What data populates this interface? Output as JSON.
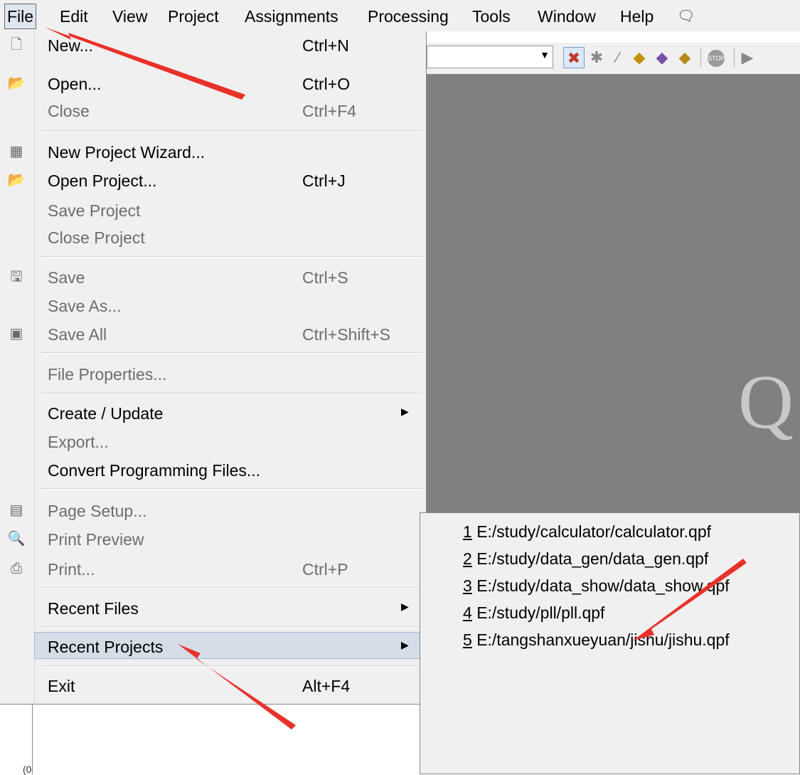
{
  "menubar": {
    "items": [
      {
        "label": "File"
      },
      {
        "label": "Edit"
      },
      {
        "label": "View"
      },
      {
        "label": "Project"
      },
      {
        "label": "Assignments"
      },
      {
        "label": "Processing"
      },
      {
        "label": "Tools"
      },
      {
        "label": "Window"
      },
      {
        "label": "Help"
      }
    ]
  },
  "toolbar": {
    "stop_label": "STOP"
  },
  "workspace": {
    "logo_letter": "Q"
  },
  "file_menu": {
    "items": [
      {
        "label": "New...",
        "shortcut": "Ctrl+N",
        "icon": "new-file-icon"
      },
      {
        "label": "Open...",
        "shortcut": "Ctrl+O",
        "icon": "open-folder-icon"
      },
      {
        "label": "Close",
        "shortcut": "Ctrl+F4"
      },
      {
        "label": "New Project Wizard...",
        "icon": "project-wizard-icon"
      },
      {
        "label": "Open Project...",
        "shortcut": "Ctrl+J",
        "icon": "open-project-icon"
      },
      {
        "label": "Save Project"
      },
      {
        "label": "Close Project"
      },
      {
        "label": "Save",
        "shortcut": "Ctrl+S",
        "icon": "save-icon"
      },
      {
        "label": "Save As..."
      },
      {
        "label": "Save All",
        "shortcut": "Ctrl+Shift+S",
        "icon": "save-all-icon"
      },
      {
        "label": "File Properties..."
      },
      {
        "label": "Create / Update"
      },
      {
        "label": "Export..."
      },
      {
        "label": "Convert Programming Files..."
      },
      {
        "label": "Page Setup...",
        "icon": "page-setup-icon"
      },
      {
        "label": "Print Preview",
        "icon": "print-preview-icon"
      },
      {
        "label": "Print...",
        "shortcut": "Ctrl+P",
        "icon": "printer-icon"
      },
      {
        "label": "Recent Files"
      },
      {
        "label": "Recent Projects"
      },
      {
        "label": "Exit",
        "shortcut": "Alt+F4"
      }
    ]
  },
  "recent_projects": {
    "items": [
      {
        "num": "1",
        "path": "E:/study/calculator/calculator.qpf"
      },
      {
        "num": "2",
        "path": "E:/study/data_gen/data_gen.qpf"
      },
      {
        "num": "3",
        "path": "E:/study/data_show/data_show.qpf"
      },
      {
        "num": "4",
        "path": "E:/study/pll/pll.qpf"
      },
      {
        "num": "5",
        "path": "E:/tangshanxueyuan/jishu/jishu.qpf"
      }
    ]
  },
  "lower_pane": {
    "tick_label": "(0"
  },
  "colors": {
    "annotation_arrow": "#e8312a",
    "highlight": "#d4dde8",
    "workspace": "#808080"
  }
}
